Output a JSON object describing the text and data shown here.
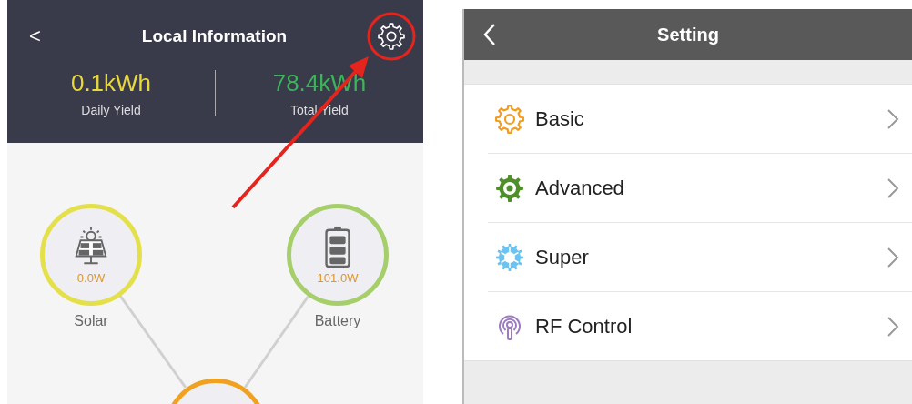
{
  "local_information": {
    "back": "<",
    "title": "Local Information",
    "stats": [
      {
        "value": "0.1kWh",
        "label": "Daily Yield",
        "color": "#e8d83a"
      },
      {
        "value": "78.4kWh",
        "label": "Total Yield",
        "color": "#3db45a"
      }
    ],
    "nodes": [
      {
        "kind": "solar",
        "reading": "0.0W",
        "label": "Solar",
        "color": "#e4e04c"
      },
      {
        "kind": "battery",
        "reading": "101.0W",
        "label": "Battery",
        "color": "#a6cf6c"
      },
      {
        "kind": "inverter",
        "color": "#f0a21e"
      }
    ]
  },
  "setting": {
    "title": "Setting",
    "items": [
      {
        "kind": "basic",
        "label": "Basic",
        "color": "#f39c1f"
      },
      {
        "kind": "advanced",
        "label": "Advanced",
        "color": "#4f8f2a"
      },
      {
        "kind": "super",
        "label": "Super",
        "color": "#6cc3f0"
      },
      {
        "kind": "rf",
        "label": "RF Control",
        "color": "#9b7cc0"
      }
    ]
  }
}
